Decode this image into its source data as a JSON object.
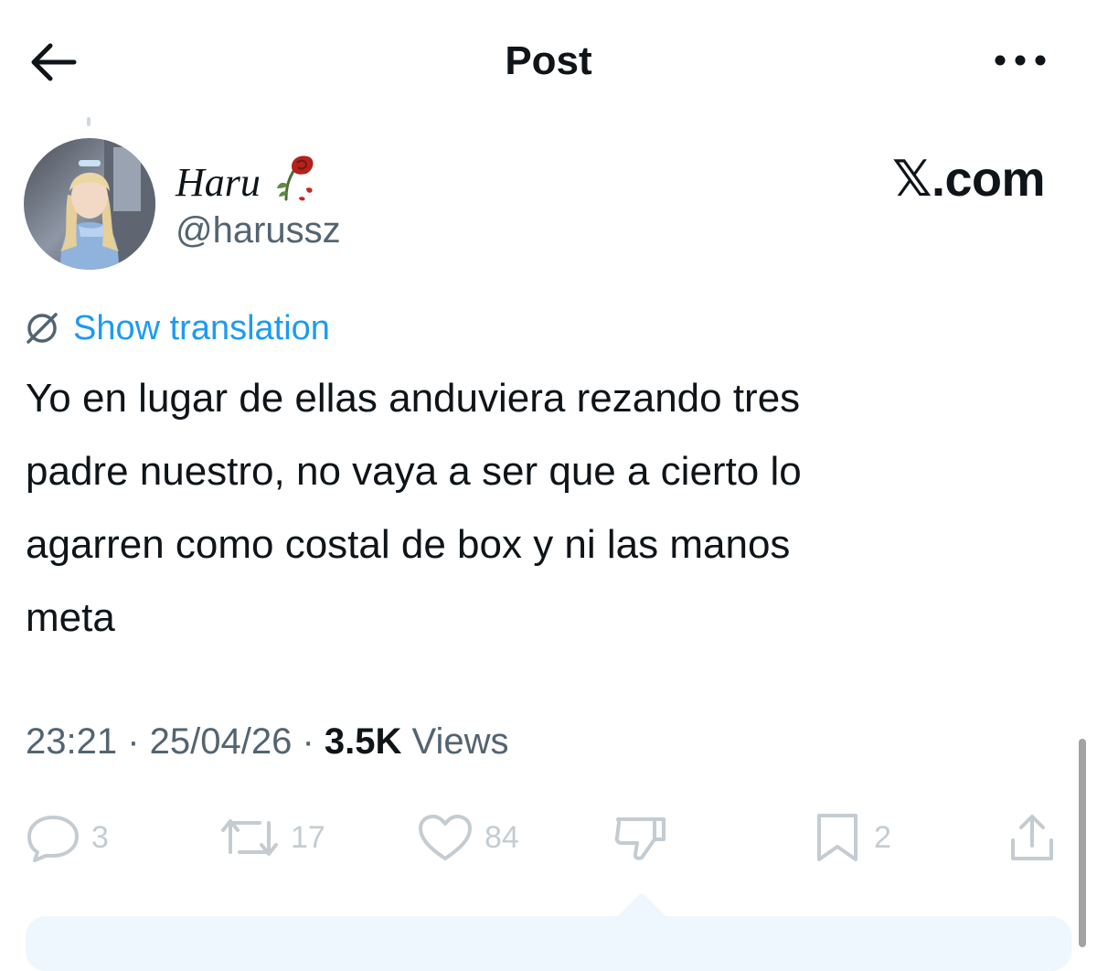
{
  "header": {
    "title": "Post"
  },
  "author": {
    "display_name": "Haru",
    "handle": "@harussz"
  },
  "brand": {
    "label": "𝕏.com"
  },
  "translation": {
    "label": "Show translation"
  },
  "post": {
    "text": "Yo en lugar de ellas anduviera rezando tres\npadre nuestro, no vaya a ser que a cierto lo\nagarren como costal  de box y ni las manos\nmeta"
  },
  "meta": {
    "time": "23:21",
    "separator": " · ",
    "date": "25/04/26",
    "views_count": "3.5K",
    "views_label": " Views"
  },
  "actions": {
    "replies": "3",
    "reposts": "17",
    "likes": "84",
    "bookmarks": "2"
  },
  "icons": {
    "back": "arrow-left-icon",
    "more": "more-horizontal-icon",
    "rose": "wilted-rose-icon",
    "translate": "globe-slash-icon",
    "reply": "reply-icon",
    "repost": "repost-icon",
    "like": "heart-icon",
    "dislike": "dislike-icon",
    "bookmark": "bookmark-icon",
    "share": "share-icon"
  },
  "colors": {
    "link": "#1d9bf0",
    "secondary_text": "#536471",
    "action_icon": "#c4ccd2",
    "panel": "#eef7fd"
  }
}
